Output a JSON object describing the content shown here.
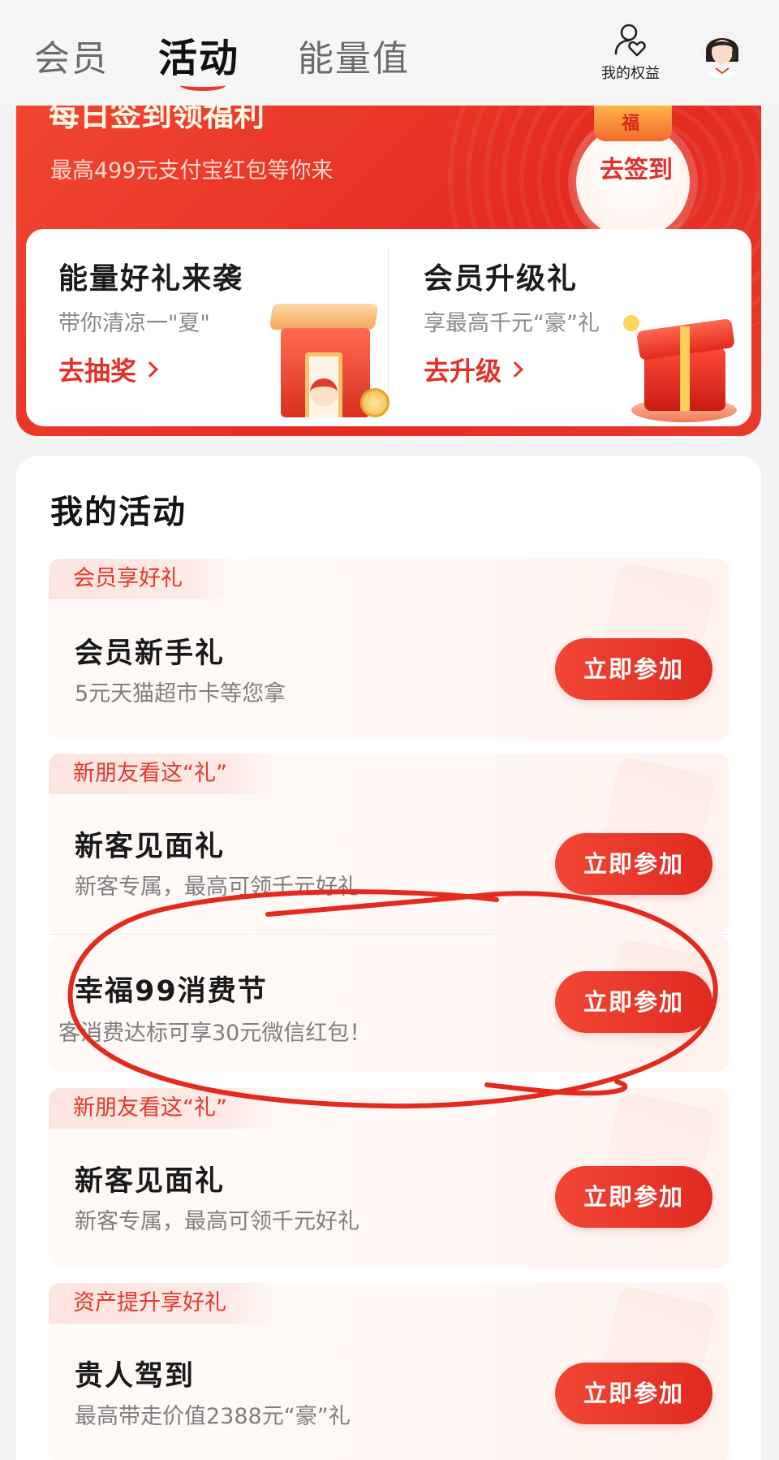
{
  "header": {
    "tabs": [
      {
        "label": "会员",
        "active": false
      },
      {
        "label": "活动",
        "active": true
      },
      {
        "label": "能量值",
        "active": false
      }
    ],
    "rights_label": "我的权益"
  },
  "banner": {
    "title": "每日签到领福利",
    "subtitle": "最高499元支付宝红包等你来",
    "checkin_button": "去签到",
    "gift_char": "福",
    "cards": [
      {
        "title": "能量好礼来袭",
        "subtitle": "带你清凉一\"夏\"",
        "link": "去抽奖"
      },
      {
        "title": "会员升级礼",
        "subtitle": "享最高千元“豪”礼",
        "link": "去升级"
      }
    ]
  },
  "my_activities": {
    "title": "我的活动",
    "join_label": "立即参加",
    "items": [
      {
        "tag": "会员享好礼",
        "name": "会员新手礼",
        "desc": "5元天猫超市卡等您拿"
      },
      {
        "tag": "新朋友看这“礼”",
        "name": "新客见面礼",
        "desc": "新客专属，最高可领千元好礼"
      },
      {
        "tag": "",
        "name": "幸福99消费节",
        "desc": "客消费达标可享30元微信红包！"
      },
      {
        "tag": "新朋友看这“礼”",
        "name": "新客见面礼",
        "desc": "新客专属，最高可领千元好礼"
      },
      {
        "tag": "资产提升享好礼",
        "name": "贵人驾到",
        "desc": "最高带走价值2388元“豪”礼"
      }
    ]
  },
  "colors": {
    "accent": "#e8392c",
    "background": "#f3f3f4",
    "annotation": "#e32a1c"
  }
}
